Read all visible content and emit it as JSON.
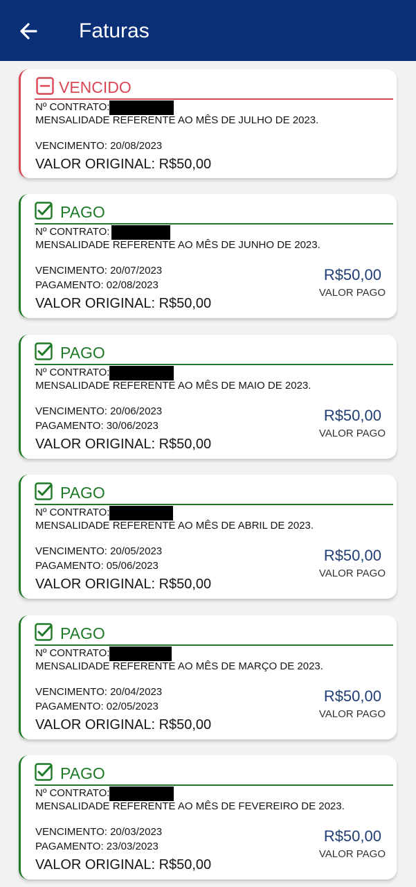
{
  "header": {
    "title": "Faturas",
    "back_icon": "arrow-left-icon",
    "background_color": "#0b2f77"
  },
  "colors": {
    "paid": "#1e7a27",
    "overdue": "#d94755",
    "amount": "#1f3d73"
  },
  "invoices": [
    {
      "status": "VENCIDO",
      "status_icon": "minus-square-icon",
      "contract_label": "Nº CONTRATO:",
      "description": "MENSALIDADE REFERENTE AO MÊS DE JULHO DE 2023.",
      "due": "VENCIMENTO: 20/08/2023",
      "original_value": "VALOR ORIGINAL: R$50,00"
    },
    {
      "status": "PAGO",
      "status_icon": "check-square-icon",
      "contract_label": "Nº CONTRATO:",
      "description": "MENSALIDADE REFERENTE AO MÊS DE JUNHO DE 2023.",
      "due": "VENCIMENTO: 20/07/2023",
      "payment": "PAGAMENTO: 02/08/2023",
      "original_value": "VALOR ORIGINAL: R$50,00",
      "paid_amount": "R$50,00",
      "paid_label": "VALOR PAGO"
    },
    {
      "status": "PAGO",
      "status_icon": "check-square-icon",
      "contract_label": "Nº CONTRATO:",
      "description": "MENSALIDADE REFERENTE AO MÊS DE MAIO DE 2023.",
      "due": "VENCIMENTO: 20/06/2023",
      "payment": "PAGAMENTO: 30/06/2023",
      "original_value": "VALOR ORIGINAL: R$50,00",
      "paid_amount": "R$50,00",
      "paid_label": "VALOR PAGO"
    },
    {
      "status": "PAGO",
      "status_icon": "check-square-icon",
      "contract_label": "Nº CONTRATO:",
      "description": "MENSALIDADE REFERENTE AO MÊS DE ABRIL DE 2023.",
      "due": "VENCIMENTO: 20/05/2023",
      "payment": "PAGAMENTO: 05/06/2023",
      "original_value": "VALOR ORIGINAL: R$50,00",
      "paid_amount": "R$50,00",
      "paid_label": "VALOR PAGO"
    },
    {
      "status": "PAGO",
      "status_icon": "check-square-icon",
      "contract_label": "Nº CONTRATO:",
      "description": "MENSALIDADE REFERENTE AO MÊS DE MARÇO DE 2023.",
      "due": "VENCIMENTO: 20/04/2023",
      "payment": "PAGAMENTO: 02/05/2023",
      "original_value": "VALOR ORIGINAL: R$50,00",
      "paid_amount": "R$50,00",
      "paid_label": "VALOR PAGO"
    },
    {
      "status": "PAGO",
      "status_icon": "check-square-icon",
      "contract_label": "Nº CONTRATO:",
      "description": "MENSALIDADE REFERENTE AO MÊS DE FEVEREIRO DE 2023.",
      "due": "VENCIMENTO: 20/03/2023",
      "payment": "PAGAMENTO: 23/03/2023",
      "original_value": "VALOR ORIGINAL: R$50,00",
      "paid_amount": "R$50,00",
      "paid_label": "VALOR PAGO"
    }
  ]
}
